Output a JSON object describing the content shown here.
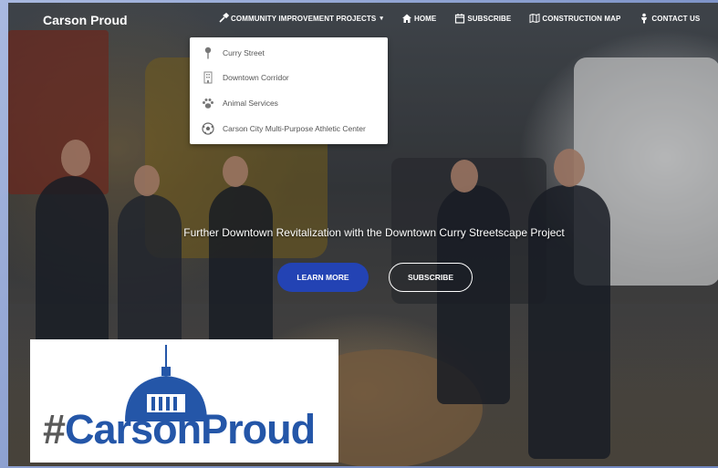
{
  "brand": "Carson Proud",
  "nav": {
    "items": [
      {
        "label": "Community Improvement Projects",
        "icon": "wrench-icon",
        "has_caret": true
      },
      {
        "label": "Home",
        "icon": "home-icon"
      },
      {
        "label": "Subscribe",
        "icon": "calendar-icon"
      },
      {
        "label": "Construction Map",
        "icon": "map-icon"
      },
      {
        "label": "Contact Us",
        "icon": "person-icon"
      }
    ],
    "caret": "▾"
  },
  "dropdown": {
    "items": [
      {
        "label": "Curry Street",
        "icon": "pin-icon"
      },
      {
        "label": "Downtown Corridor",
        "icon": "building-icon"
      },
      {
        "label": "Animal Services",
        "icon": "paw-icon"
      },
      {
        "label": "Carson City Multi-Purpose Athletic Center",
        "icon": "soccer-ball-icon"
      }
    ]
  },
  "hero": {
    "tagline": "Further Downtown Revitalization with the Downtown Curry Streetscape Project",
    "learn_more": "LEARN MORE",
    "subscribe": "SUBSCRIBE"
  },
  "logo": {
    "hash": "#",
    "carson": "Carson",
    "proud": "Proud"
  },
  "colors": {
    "accent": "#2343b4",
    "logo_blue": "#2456a8",
    "frame": "#8ea3d4"
  }
}
